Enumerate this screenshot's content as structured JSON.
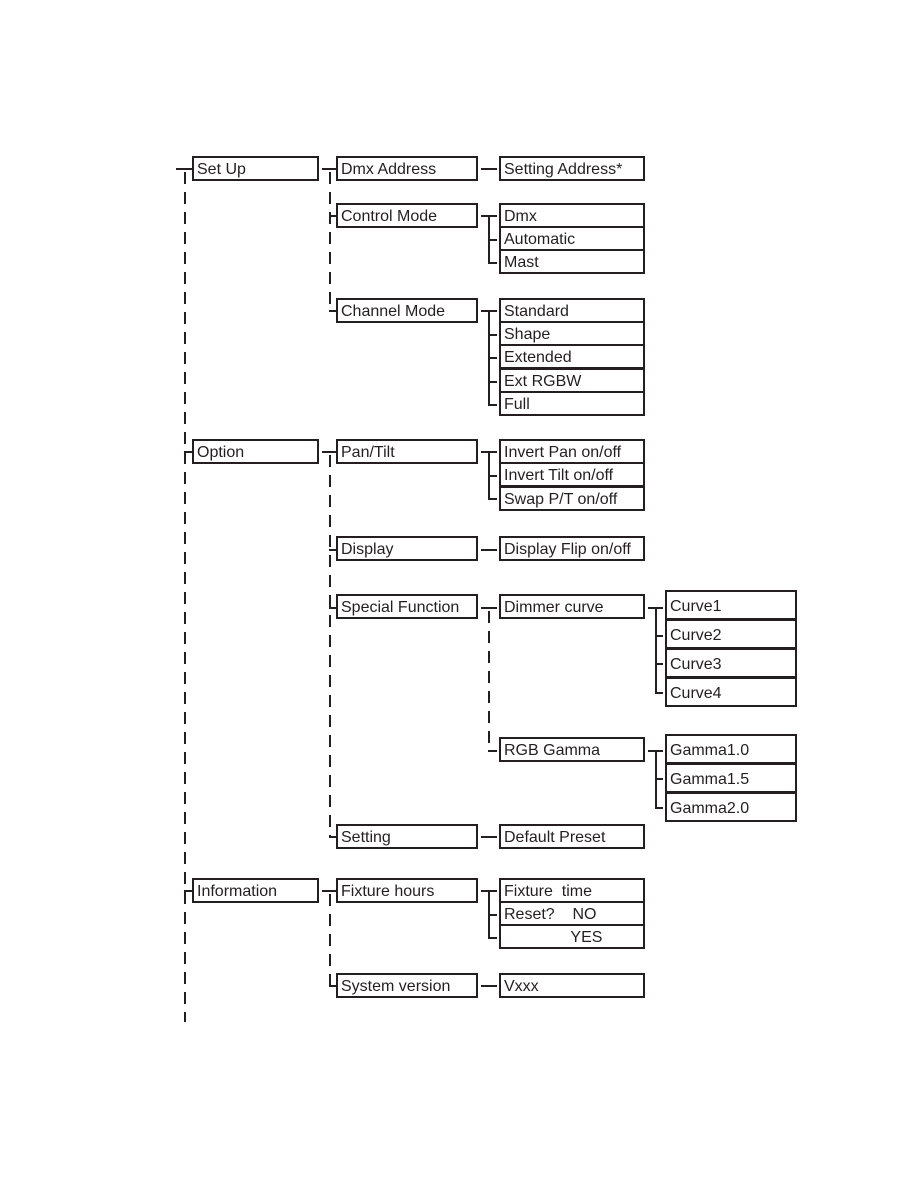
{
  "menu_tree": {
    "set_up": {
      "label": "Set Up",
      "dmx_address": {
        "label": "Dmx Address",
        "value": "Setting Address*"
      },
      "control_mode": {
        "label": "Control Mode",
        "options": [
          "Dmx",
          "Automatic",
          "Mast"
        ]
      },
      "channel_mode": {
        "label": "Channel Mode",
        "options": [
          "Standard",
          "Shape",
          "Extended",
          "Ext RGBW",
          "Full"
        ]
      }
    },
    "option": {
      "label": "Option",
      "pan_tilt": {
        "label": "Pan/Tilt",
        "options": [
          "Invert Pan on/off",
          "Invert Tilt on/off",
          "Swap P/T on/off"
        ]
      },
      "display": {
        "label": "Display",
        "value": "Display Flip on/off"
      },
      "special_function": {
        "label": "Special Function",
        "dimmer_curve": {
          "label": "Dimmer curve",
          "options": [
            "Curve1",
            "Curve2",
            "Curve3",
            "Curve4"
          ]
        },
        "rgb_gamma": {
          "label": "RGB Gamma",
          "options": [
            "Gamma1.0",
            "Gamma1.5",
            "Gamma2.0"
          ]
        }
      },
      "setting": {
        "label": "Setting",
        "value": "Default Preset"
      }
    },
    "information": {
      "label": "Information",
      "fixture_hours": {
        "label": "Fixture hours",
        "options": [
          "Fixture  time",
          "Reset?    NO",
          "               YES"
        ]
      },
      "system_version": {
        "label": "System version",
        "value": "Vxxx"
      }
    }
  }
}
